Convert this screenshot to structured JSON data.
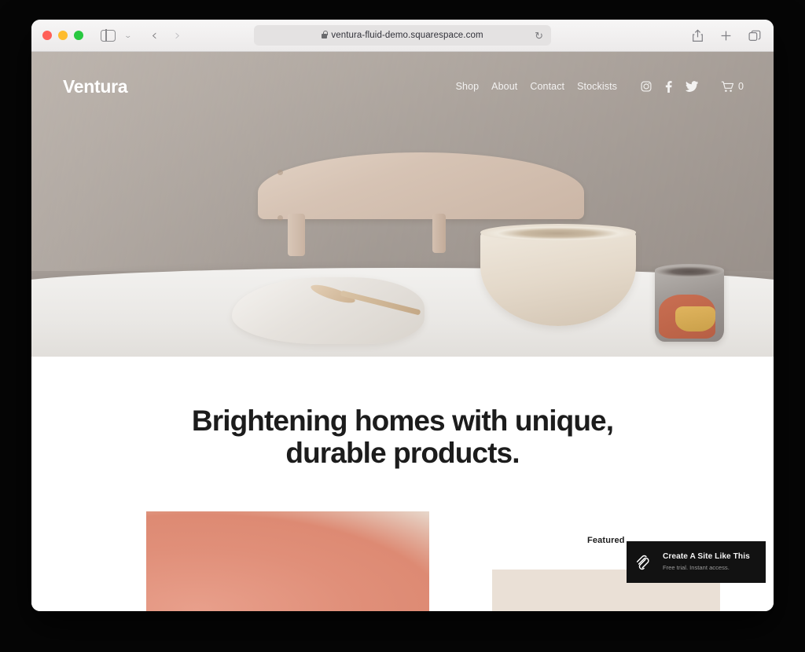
{
  "browser": {
    "traffic_lights": [
      {
        "name": "close",
        "color": "#ff5f57"
      },
      {
        "name": "minimize",
        "color": "#febc2e"
      },
      {
        "name": "zoom",
        "color": "#28c840"
      }
    ],
    "sidebar_icon": "sidebar-icon",
    "sidebar_chevron": "⌄",
    "back_arrow": "‹",
    "forward_arrow": "›",
    "url": "ventura-fluid-demo.squarespace.com",
    "lock_icon": "lock-icon",
    "reload_icon": "↻",
    "right_icons": [
      "share-icon",
      "new-tab-icon",
      "tab-overview-icon"
    ]
  },
  "site": {
    "brand": "Ventura",
    "nav_links": [
      {
        "label": "Shop"
      },
      {
        "label": "About"
      },
      {
        "label": "Contact"
      },
      {
        "label": "Stockists"
      }
    ],
    "social": [
      {
        "name": "instagram-icon"
      },
      {
        "name": "facebook-icon"
      },
      {
        "name": "twitter-icon"
      }
    ],
    "cart": {
      "icon": "cart-icon",
      "count": "0"
    },
    "headline_line1": "Brightening homes with unique,",
    "headline_line2": "durable products.",
    "featured_label": "Featured",
    "hero_image_alt": "wooden chair back, linen cloth, wooden spoon, ceramic bowl and glazed cup on white table"
  },
  "promo": {
    "logo": "squarespace-logo",
    "title": "Create A Site Like This",
    "subtitle": "Free trial. Instant access."
  },
  "colors": {
    "promo_bg": "#121212",
    "hero_wall": "#a8a09a",
    "product_coral": "#dd8a73",
    "featured_block": "#eae0d6",
    "text_dark": "#1c1c1c"
  }
}
